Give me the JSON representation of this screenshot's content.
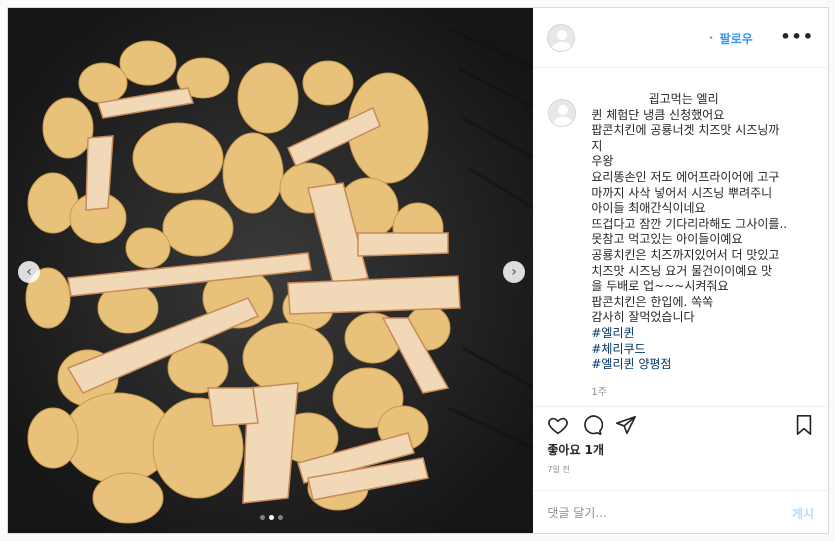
{
  "header": {
    "separator": "•",
    "follow_label": "팔로우",
    "more_icon": "more-icon"
  },
  "caption": {
    "lines": [
      "               굅고먹는 엘리",
      "퀸 체험단 냉큼 신청했어요",
      "팝콘치킨에 공룡너겟 치즈맛 시즈닝까",
      "지",
      "우왕",
      "요리똥손인 저도 에어프라이어에 고구",
      "마까지 사삭 넣어서 시즈닝 뿌려주니",
      "아이들 최애간식이네요",
      "뜨겁다고 잠깐 기다리라해도 그사이를..",
      "못참고 먹고있는 아이들이예요",
      "공룡치킨은 치즈까지있어서 더 맛있고",
      "치즈맛 시즈닝 요거 물건이이예요 맛",
      "을 두배로 업~~~시켜줘요",
      "팝콘치킨은 한입에. 쏙쏙",
      "감사히 잘먹었습니다"
    ],
    "hashtags": [
      "#엘리퀸",
      "#체리쿠드",
      "#엘리퀸 양평점"
    ],
    "time_ago": "1주"
  },
  "actions": {
    "like_icon": "heart-icon",
    "comment_icon": "comment-icon",
    "share_icon": "share-icon",
    "save_icon": "bookmark-icon"
  },
  "likes_label": "좋아요 1개",
  "posted_label": "7일 전",
  "comment_box": {
    "placeholder": "댓글 달기...",
    "post_label": "게시"
  },
  "media": {
    "prev_glyph": "‹",
    "next_glyph": "›",
    "slide_count": 3,
    "active_slide": 1
  }
}
